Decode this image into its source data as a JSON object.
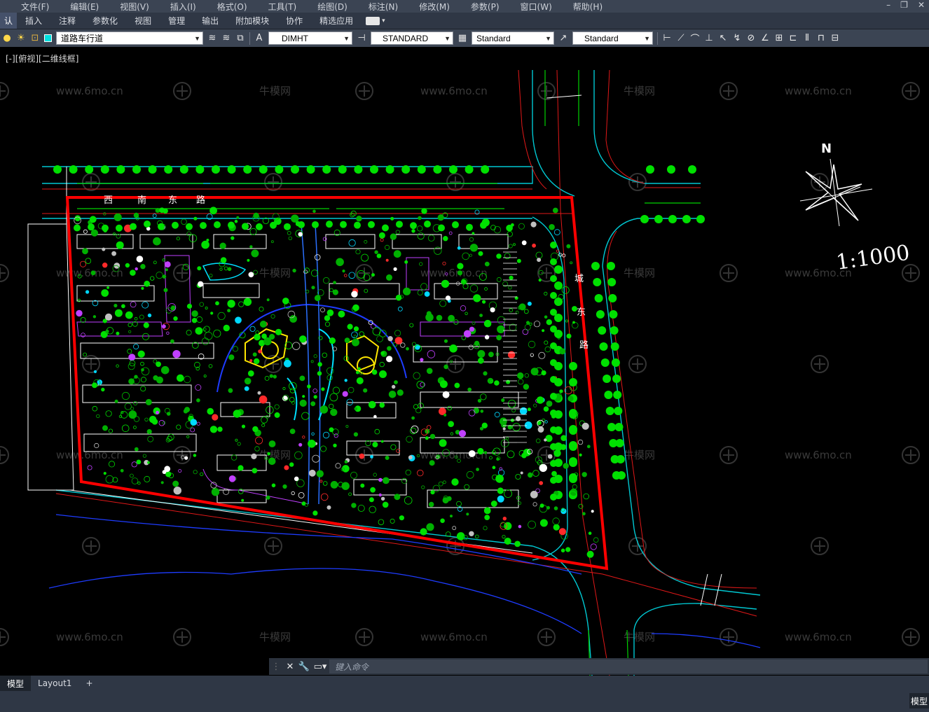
{
  "menu": {
    "items": [
      "文件(F)",
      "编辑(E)",
      "视图(V)",
      "插入(I)",
      "格式(O)",
      "工具(T)",
      "绘图(D)",
      "标注(N)",
      "修改(M)",
      "参数(P)",
      "窗口(W)",
      "帮助(H)"
    ]
  },
  "ribbon": {
    "tabs": [
      "认",
      "插入",
      "注释",
      "参数化",
      "视图",
      "管理",
      "输出",
      "附加模块",
      "协作",
      "精选应用"
    ]
  },
  "toolbar": {
    "layer": "道路车行道",
    "dimstyle": "DIMHT",
    "textstyle": "STANDARD",
    "tablestyle": "Standard",
    "mleaderstyle": "Standard"
  },
  "viewport": {
    "label": "[-][俯视][二维线框]",
    "scale_text": "1:1000",
    "north_label": "N",
    "road_label_east": [
      "城",
      "东",
      "路"
    ],
    "road_label_north": [
      "西",
      "南",
      "东",
      "路"
    ],
    "watermark_url": "www.6mo.cn",
    "watermark_cn": "牛模网"
  },
  "command": {
    "placeholder": "键入命令"
  },
  "layouts": {
    "tabs": [
      "模型",
      "Layout1"
    ],
    "add": "+"
  },
  "status": {
    "model": "模型"
  },
  "colors": {
    "boundary": "#ff0000",
    "road": "#00c8d2",
    "tree": "#00e000",
    "building": "#ffffff",
    "accent_purple": "#c040ff",
    "water": "#1e3cff",
    "yellow": "#ffe600"
  }
}
